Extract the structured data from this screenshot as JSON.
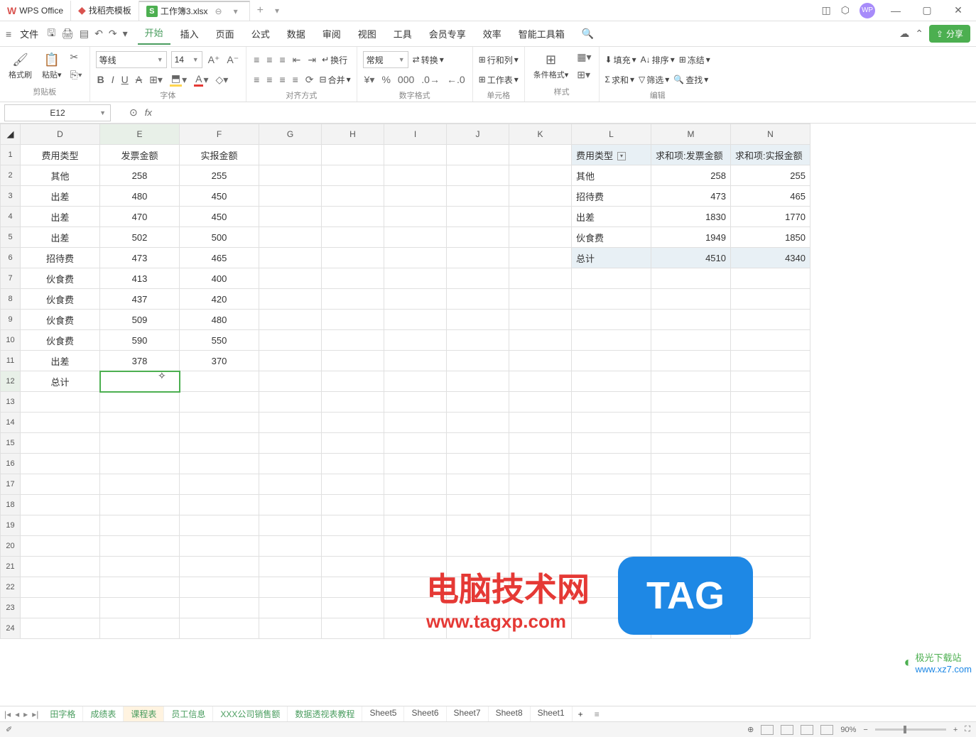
{
  "titlebar": {
    "tabs": [
      {
        "icon": "w",
        "label": "WPS Office"
      },
      {
        "icon": "d",
        "label": "找稻壳模板"
      },
      {
        "icon": "s",
        "label": "工作簿3.xlsx",
        "active": true
      }
    ],
    "add": "+",
    "avatar": "WP",
    "win": {
      "min": "—",
      "max": "▢",
      "close": "✕"
    }
  },
  "menubar": {
    "file": "文件",
    "items": [
      "开始",
      "插入",
      "页面",
      "公式",
      "数据",
      "审阅",
      "视图",
      "工具",
      "会员专享",
      "效率",
      "智能工具箱"
    ],
    "active_index": 0,
    "share": "分享"
  },
  "ribbon": {
    "clipboard": {
      "format_painter": "格式刷",
      "paste": "粘贴",
      "label": "剪贴板"
    },
    "font": {
      "name": "等线",
      "size": "14",
      "bold": "B",
      "italic": "I",
      "underline": "U",
      "strike": "A",
      "label": "字体"
    },
    "align": {
      "wrap": "换行",
      "merge": "合并",
      "label": "对齐方式"
    },
    "number": {
      "general": "常规",
      "convert": "转换",
      "label": "数字格式"
    },
    "cells": {
      "rowcol": "行和列",
      "worksheet": "工作表",
      "label": "单元格"
    },
    "styles": {
      "cond": "条件格式",
      "label": "样式"
    },
    "editing": {
      "fill": "填充",
      "sort": "排序",
      "sum": "求和",
      "filter": "筛选",
      "freeze": "冻结",
      "find": "查找",
      "label": "编辑"
    }
  },
  "namebox": "E12",
  "fx": "fx",
  "columns": [
    "D",
    "E",
    "F",
    "G",
    "H",
    "I",
    "J",
    "K",
    "L",
    "M",
    "N"
  ],
  "main_table": {
    "headers": [
      "费用类型",
      "发票金额",
      "实报金额"
    ],
    "rows": [
      [
        "其他",
        "258",
        "255"
      ],
      [
        "出差",
        "480",
        "450"
      ],
      [
        "出差",
        "470",
        "450"
      ],
      [
        "出差",
        "502",
        "500"
      ],
      [
        "招待费",
        "473",
        "465"
      ],
      [
        "伙食费",
        "413",
        "400"
      ],
      [
        "伙食费",
        "437",
        "420"
      ],
      [
        "伙食费",
        "509",
        "480"
      ],
      [
        "伙食费",
        "590",
        "550"
      ],
      [
        "出差",
        "378",
        "370"
      ]
    ],
    "total_label": "总计"
  },
  "pivot": {
    "headers": [
      "费用类型",
      "求和项:发票金额",
      "求和项:实报金额"
    ],
    "rows": [
      [
        "其他",
        "258",
        "255"
      ],
      [
        "招待费",
        "473",
        "465"
      ],
      [
        "出差",
        "1830",
        "1770"
      ],
      [
        "伙食费",
        "1949",
        "1850"
      ]
    ],
    "total": [
      "总计",
      "4510",
      "4340"
    ]
  },
  "watermark": {
    "line1": "电脑技术网",
    "line2": "www.tagxp.com",
    "tag": "TAG",
    "jg1": "极光下载站",
    "jg2": "www.xz7.com"
  },
  "sheets": [
    "田字格",
    "成绩表",
    "课程表",
    "员工信息",
    "XXX公司销售额",
    "数据透视表教程",
    "Sheet5",
    "Sheet6",
    "Sheet7",
    "Sheet8",
    "Sheet1"
  ],
  "sheets_active": 2,
  "sheets_green_until": 6,
  "statusbar": {
    "zoom": "90%"
  }
}
